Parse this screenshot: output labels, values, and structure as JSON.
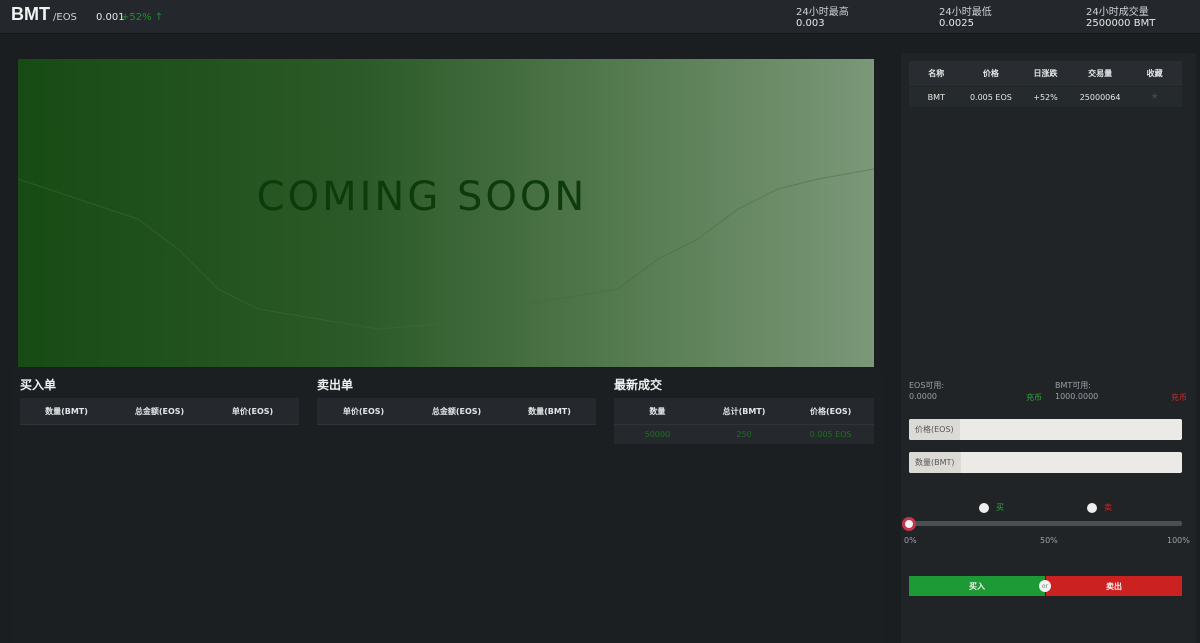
{
  "header": {
    "pair": "BMT",
    "quote": "/EOS",
    "last_price": "0.001",
    "change": "+52% ↑",
    "stats": [
      {
        "label": "24小时最高",
        "value": "0.003"
      },
      {
        "label": "24小时最低",
        "value": "0.0025"
      },
      {
        "label": "24小时成交量",
        "value": "2500000 BMT"
      }
    ]
  },
  "chart": {
    "overlay_text": "COMING SOON"
  },
  "buy_orders": {
    "title": "买入单",
    "columns": [
      "数量(BMT)",
      "总金额(EOS)",
      "单价(EOS)"
    ]
  },
  "sell_orders": {
    "title": "卖出单",
    "columns": [
      "单价(EOS)",
      "总金额(EOS)",
      "数量(BMT)"
    ]
  },
  "latest_trades": {
    "title": "最新成交",
    "columns": [
      "数量",
      "总计(BMT)",
      "价格(EOS)"
    ],
    "rows": [
      {
        "amount": "50000",
        "total": "250",
        "price": "0.005 EOS"
      }
    ]
  },
  "market": {
    "columns": [
      "名称",
      "价格",
      "日涨跌",
      "交易量",
      "收藏"
    ],
    "rows": [
      {
        "name": "BMT",
        "price": "0.005 EOS",
        "change": "+52%",
        "volume": "25000064",
        "fav": "★"
      }
    ]
  },
  "trade_form": {
    "eos_available_label": "EOS可用:",
    "eos_available_value": "0.0000",
    "eos_recharge": "充币",
    "bmt_available_label": "BMT可用:",
    "bmt_available_value": "1000.0000",
    "bmt_recharge": "充币",
    "price_label": "价格(EOS)",
    "amount_label": "数量(BMT)",
    "option_buy": "买",
    "option_sell": "卖",
    "slider_level_percent": 0,
    "slider_marks": [
      "0%",
      "50%",
      "100%"
    ],
    "buy_button": "买入",
    "sell_button": "卖出",
    "or_text": "or"
  },
  "colors": {
    "buy_green": "#1d9a35",
    "sell_red": "#cc2121",
    "up_green": "#1d8f2e"
  }
}
